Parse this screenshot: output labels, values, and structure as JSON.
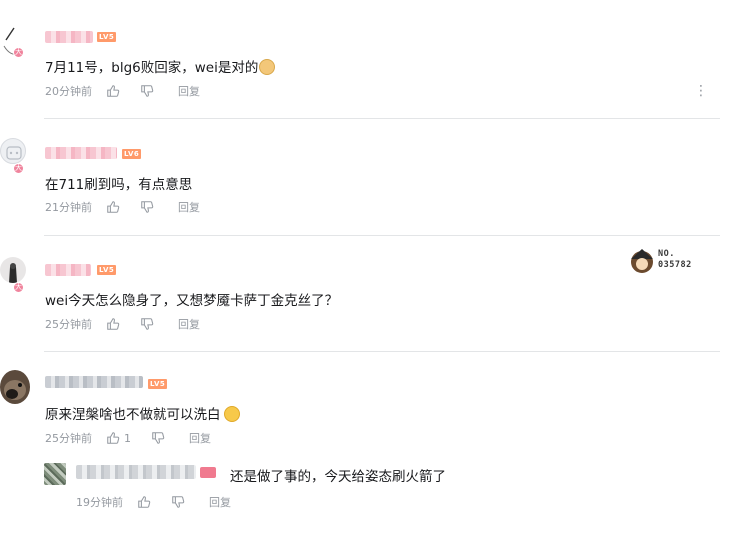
{
  "comments": [
    {
      "text": "7月11号，blg6败回家，wei是对的",
      "time": "20分钟前",
      "reply_label": "回复",
      "level": "LV5",
      "avatar_badge": "大",
      "emoji": "doge"
    },
    {
      "text": "在711刷到吗，有点意思",
      "time": "21分钟前",
      "reply_label": "回复",
      "level": "LV6",
      "avatar_badge": "大"
    },
    {
      "text": "wei今天怎么隐身了，又想梦魇卡萨丁金克丝了？",
      "time": "25分钟前",
      "reply_label": "回复",
      "level": "LV5",
      "avatar_badge": "大",
      "fan_badge_text": "NO.\n035782"
    },
    {
      "text": "原来涅槃啥也不做就可以洗白",
      "time": "25分钟前",
      "reply_label": "回复",
      "level": "LV5",
      "like_count": "1",
      "emoji": "laugh-cry"
    }
  ],
  "sub_reply": {
    "text": "还是做了事的，今天给姿态刷火箭了",
    "time": "19分钟前",
    "reply_label": "回复"
  },
  "colors": {
    "text": "#18191c",
    "meta": "#9499a0",
    "divider": "#e3e5e7",
    "level_badge": "#ff9a6a",
    "username_pink": "#f7c6d1"
  }
}
